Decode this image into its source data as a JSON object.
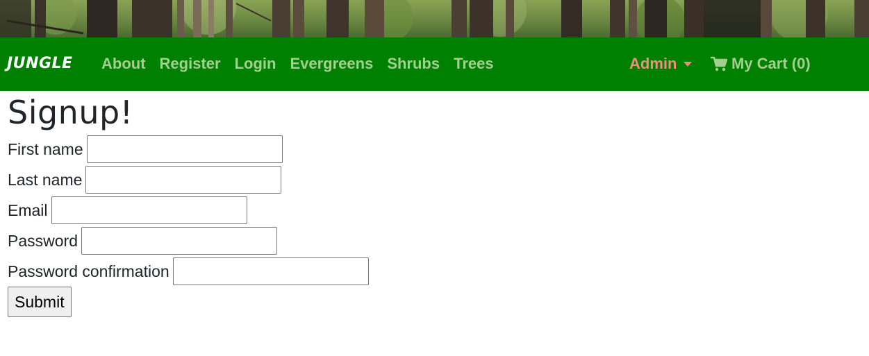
{
  "navbar": {
    "brand": "JUNGLE",
    "links": [
      "About",
      "Register",
      "Login",
      "Evergreens",
      "Shrubs",
      "Trees"
    ],
    "admin_label": "Admin",
    "cart_label": "My Cart (0)",
    "colors": {
      "background": "#008000",
      "link": "#a4d08f",
      "admin": "#f08f7c",
      "brand": "#ffffff"
    }
  },
  "banner": {
    "icon": "forest-image"
  },
  "form": {
    "title": "Signup!",
    "fields": [
      {
        "label": "First name",
        "value": ""
      },
      {
        "label": "Last name",
        "value": ""
      },
      {
        "label": "Email",
        "value": ""
      },
      {
        "label": "Password",
        "value": ""
      },
      {
        "label": "Password confirmation",
        "value": ""
      }
    ],
    "submit_label": "Submit"
  }
}
